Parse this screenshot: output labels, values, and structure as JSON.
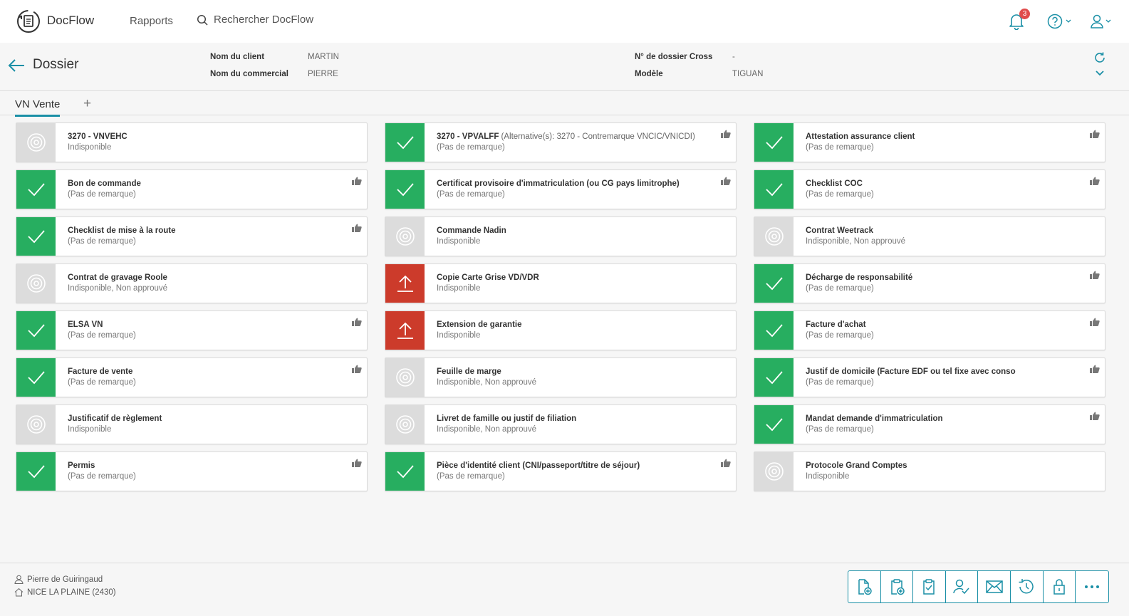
{
  "app": {
    "name": "DocFlow"
  },
  "nav": {
    "rapports": "Rapports",
    "search_label": "Rechercher DocFlow"
  },
  "notifications": {
    "count": "3"
  },
  "dossier": {
    "title": "Dossier",
    "client_label": "Nom du client",
    "client_value": "MARTIN",
    "commercial_label": "Nom du commercial",
    "commercial_value": "PIERRE",
    "cross_label": "N° de dossier Cross",
    "cross_value": "-",
    "modele_label": "Modèle",
    "modele_value": "TIGUAN"
  },
  "tabs": {
    "active": "VN Vente",
    "add": "+"
  },
  "documents": [
    {
      "title": "3270 - VNVEHC",
      "alt": "",
      "sub": "Indisponible",
      "status": "na",
      "thumb": false
    },
    {
      "title": "3270 - VPVALFF",
      "alt": " (Alternative(s): 3270 - Contremarque VNCIC/VNICDI)",
      "sub": "(Pas de remarque)",
      "status": "ok",
      "thumb": true
    },
    {
      "title": "Attestation assurance client",
      "alt": "",
      "sub": "(Pas de remarque)",
      "status": "ok",
      "thumb": true
    },
    {
      "title": "Bon de commande",
      "alt": "",
      "sub": "(Pas de remarque)",
      "status": "ok",
      "thumb": true
    },
    {
      "title": "Certificat provisoire d'immatriculation (ou CG pays limitrophe)",
      "alt": "",
      "sub": "(Pas de remarque)",
      "status": "ok",
      "thumb": true
    },
    {
      "title": "Checklist COC",
      "alt": "",
      "sub": "(Pas de remarque)",
      "status": "ok",
      "thumb": true
    },
    {
      "title": "Checklist de mise à la route",
      "alt": "",
      "sub": "(Pas de remarque)",
      "status": "ok",
      "thumb": true
    },
    {
      "title": "Commande Nadin",
      "alt": "",
      "sub": "Indisponible",
      "status": "na",
      "thumb": false
    },
    {
      "title": "Contrat Weetrack",
      "alt": "",
      "sub": "Indisponible, Non approuvé",
      "status": "na",
      "thumb": false
    },
    {
      "title": "Contrat de gravage Roole",
      "alt": "",
      "sub": "Indisponible, Non approuvé",
      "status": "na",
      "thumb": false
    },
    {
      "title": "Copie Carte Grise VD/VDR",
      "alt": "",
      "sub": "Indisponible",
      "status": "up",
      "thumb": false
    },
    {
      "title": "Décharge de responsabilité",
      "alt": "",
      "sub": "(Pas de remarque)",
      "status": "ok",
      "thumb": true
    },
    {
      "title": "ELSA VN",
      "alt": "",
      "sub": "(Pas de remarque)",
      "status": "ok",
      "thumb": true
    },
    {
      "title": "Extension de garantie",
      "alt": "",
      "sub": "Indisponible",
      "status": "up",
      "thumb": false
    },
    {
      "title": "Facture d'achat",
      "alt": "",
      "sub": "(Pas de remarque)",
      "status": "ok",
      "thumb": true
    },
    {
      "title": "Facture de vente",
      "alt": "",
      "sub": "(Pas de remarque)",
      "status": "ok",
      "thumb": true
    },
    {
      "title": "Feuille de marge",
      "alt": "",
      "sub": "Indisponible, Non approuvé",
      "status": "na",
      "thumb": false
    },
    {
      "title": "Justif de domicile (Facture EDF ou tel fixe avec conso",
      "alt": "",
      "sub": "(Pas de remarque)",
      "status": "ok",
      "thumb": true
    },
    {
      "title": "Justificatif de règlement",
      "alt": "",
      "sub": "Indisponible",
      "status": "na",
      "thumb": false
    },
    {
      "title": "Livret de famille ou justif de filiation",
      "alt": "",
      "sub": "Indisponible, Non approuvé",
      "status": "na",
      "thumb": false
    },
    {
      "title": "Mandat demande d'immatriculation",
      "alt": "",
      "sub": "(Pas de remarque)",
      "status": "ok",
      "thumb": true
    },
    {
      "title": "Permis",
      "alt": "",
      "sub": "(Pas de remarque)",
      "status": "ok",
      "thumb": true
    },
    {
      "title": "Pièce d'identité client (CNI/passeport/titre de séjour)",
      "alt": "",
      "sub": "(Pas de remarque)",
      "status": "ok",
      "thumb": true
    },
    {
      "title": "Protocole Grand Comptes",
      "alt": "",
      "sub": "Indisponible",
      "status": "na",
      "thumb": false
    }
  ],
  "footer": {
    "user": "Pierre de Guiringaud",
    "site": "NICE LA PLAINE (2430)"
  },
  "toolbar": [
    "add-document-icon",
    "add-clipboard-icon",
    "checklist-icon",
    "user-check-icon",
    "mail-icon",
    "history-icon",
    "lock-icon",
    "more-icon"
  ],
  "colors": {
    "accent": "#1a8fa6",
    "ok": "#27ae60",
    "missing": "#cc3b2b",
    "unavailable": "#dcdcdc"
  }
}
